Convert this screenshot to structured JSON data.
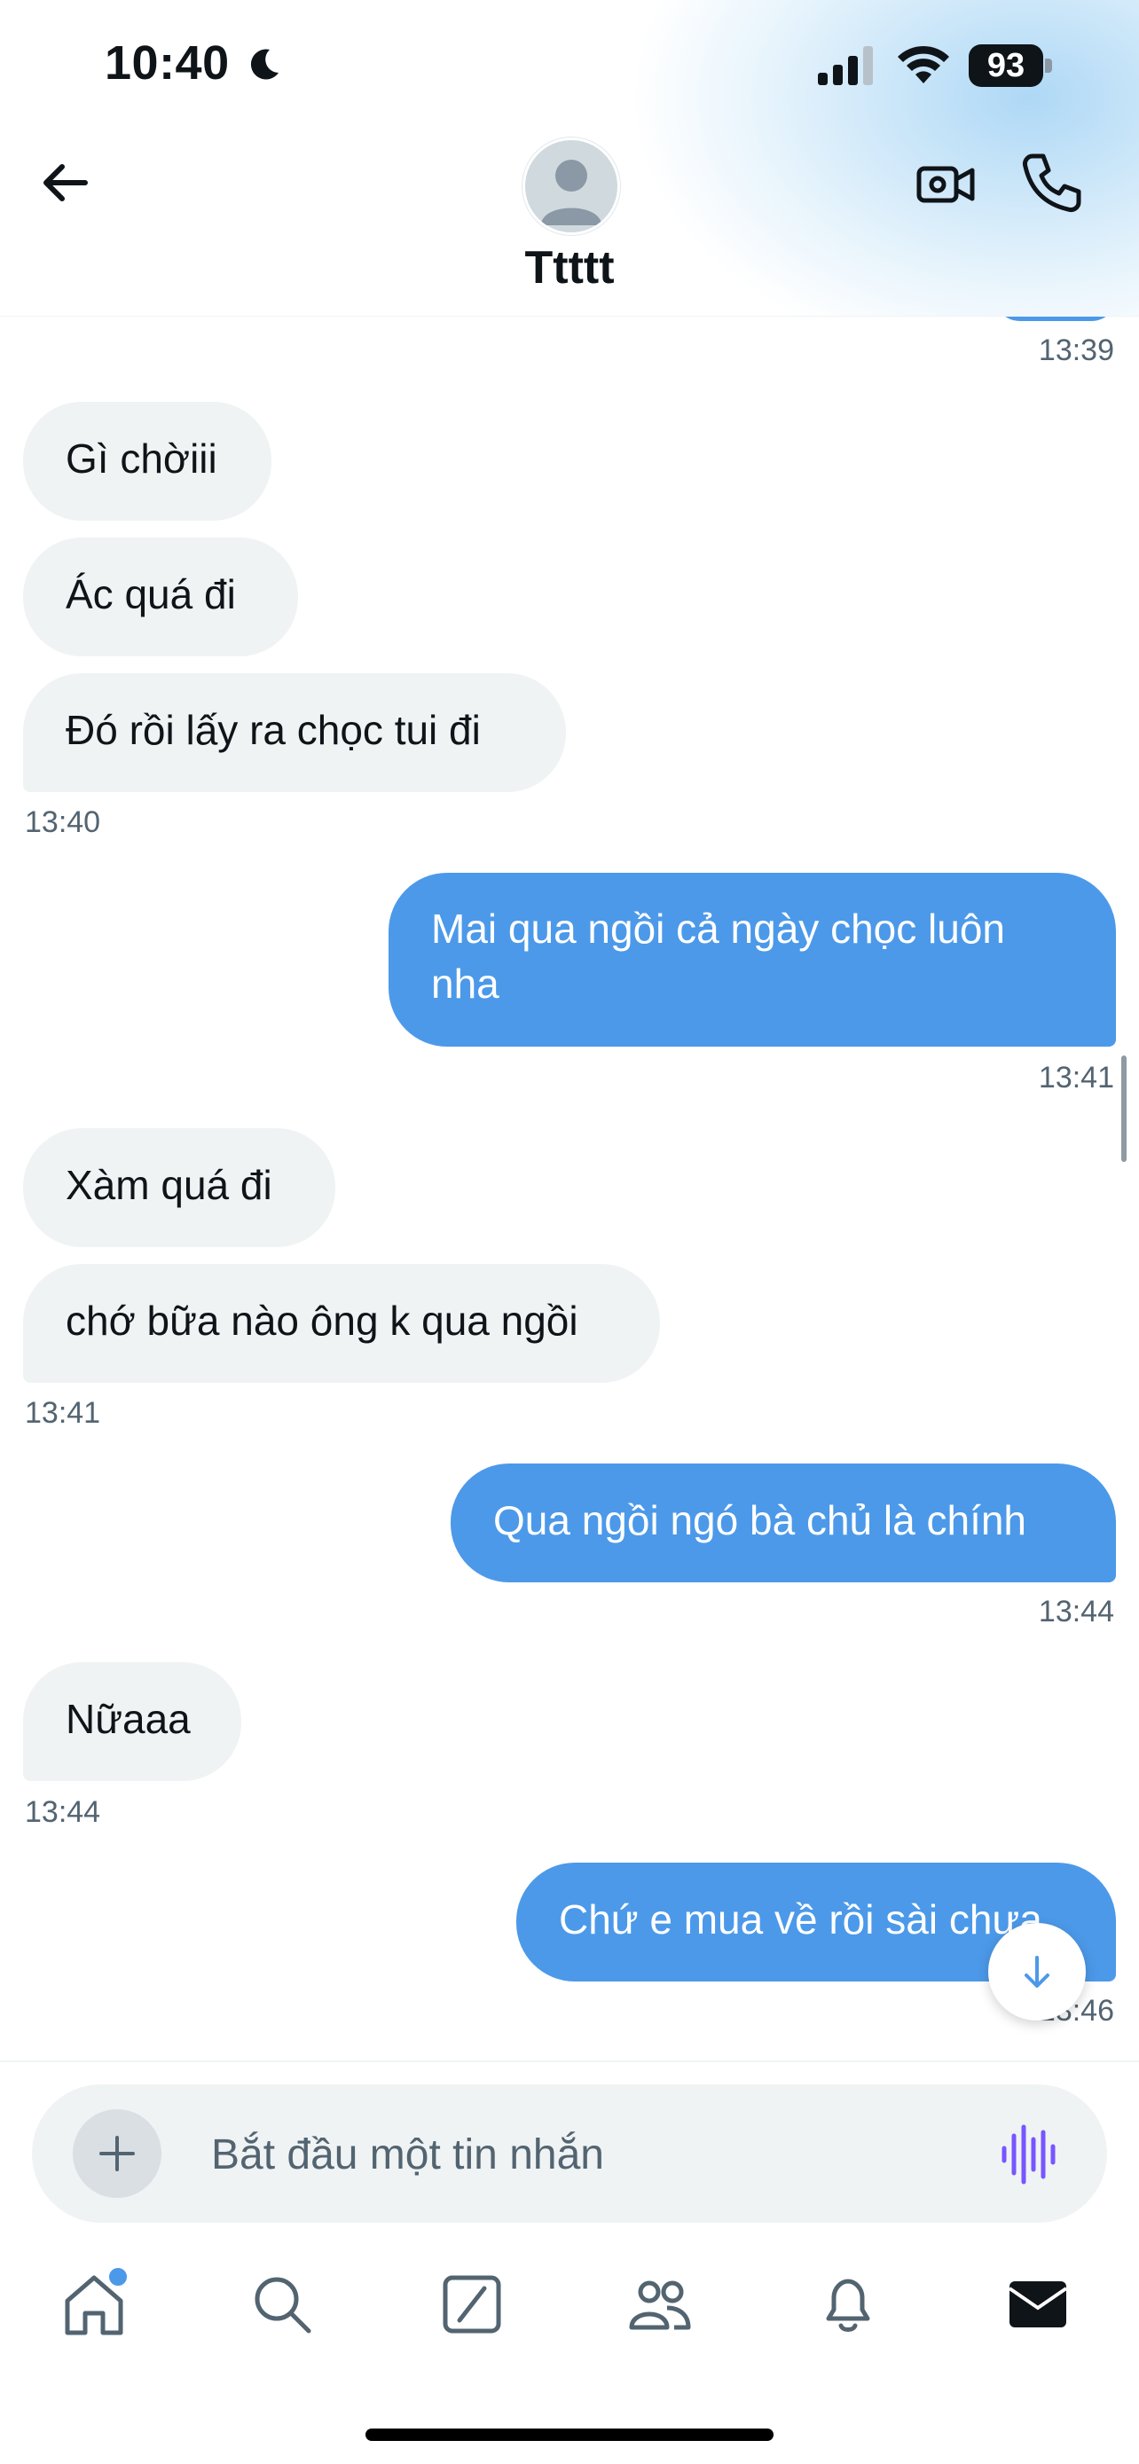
{
  "status_bar": {
    "time": "10:40",
    "battery": "93",
    "icons": [
      "moon-icon",
      "signal-icon",
      "wifi-icon",
      "battery-icon"
    ]
  },
  "header": {
    "contact_name": "Ttttt",
    "icons": {
      "back": "arrow-left-icon",
      "video": "video-call-icon",
      "call": "phone-icon",
      "avatar": "default-avatar"
    }
  },
  "messages": {
    "top_timestamp": "13:39",
    "m1": "Gì chờiii",
    "m2": "Ác quá đi",
    "m3": "Đó rồi lấy ra chọc tui đi",
    "ts1": "13:40",
    "m4": "Mai qua ngồi cả ngày chọc luôn nha",
    "ts2": "13:41",
    "m5": "Xàm quá đi",
    "m6": "chớ bữa nào ông k qua ngồi",
    "ts3": "13:41",
    "m7": "Qua ngồi ngó bà chủ là chính",
    "ts4": "13:44",
    "m8": "Nữaaa",
    "ts5": "13:44",
    "m9": "Chứ e mua về rồi sài chưa",
    "ts6": "13:46"
  },
  "composer": {
    "placeholder": "Bắt đầu một tin nhắn",
    "accent": "#7856ff"
  },
  "bottom_nav": [
    "home-icon",
    "search-icon",
    "grok-icon",
    "communities-icon",
    "notifications-icon",
    "messages-icon"
  ],
  "colors": {
    "outgoing": "#4c99e9",
    "incoming": "#eff3f4",
    "text": "#0f1419",
    "muted": "#536471"
  }
}
